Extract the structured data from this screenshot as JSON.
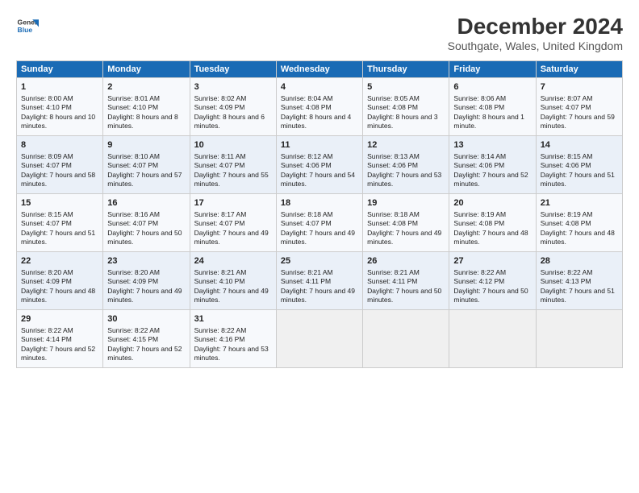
{
  "header": {
    "logo_line1": "General",
    "logo_line2": "Blue",
    "title": "December 2024",
    "subtitle": "Southgate, Wales, United Kingdom"
  },
  "days_of_week": [
    "Sunday",
    "Monday",
    "Tuesday",
    "Wednesday",
    "Thursday",
    "Friday",
    "Saturday"
  ],
  "weeks": [
    [
      {
        "day": "1",
        "sunrise": "Sunrise: 8:00 AM",
        "sunset": "Sunset: 4:10 PM",
        "daylight": "Daylight: 8 hours and 10 minutes."
      },
      {
        "day": "2",
        "sunrise": "Sunrise: 8:01 AM",
        "sunset": "Sunset: 4:10 PM",
        "daylight": "Daylight: 8 hours and 8 minutes."
      },
      {
        "day": "3",
        "sunrise": "Sunrise: 8:02 AM",
        "sunset": "Sunset: 4:09 PM",
        "daylight": "Daylight: 8 hours and 6 minutes."
      },
      {
        "day": "4",
        "sunrise": "Sunrise: 8:04 AM",
        "sunset": "Sunset: 4:08 PM",
        "daylight": "Daylight: 8 hours and 4 minutes."
      },
      {
        "day": "5",
        "sunrise": "Sunrise: 8:05 AM",
        "sunset": "Sunset: 4:08 PM",
        "daylight": "Daylight: 8 hours and 3 minutes."
      },
      {
        "day": "6",
        "sunrise": "Sunrise: 8:06 AM",
        "sunset": "Sunset: 4:08 PM",
        "daylight": "Daylight: 8 hours and 1 minute."
      },
      {
        "day": "7",
        "sunrise": "Sunrise: 8:07 AM",
        "sunset": "Sunset: 4:07 PM",
        "daylight": "Daylight: 7 hours and 59 minutes."
      }
    ],
    [
      {
        "day": "8",
        "sunrise": "Sunrise: 8:09 AM",
        "sunset": "Sunset: 4:07 PM",
        "daylight": "Daylight: 7 hours and 58 minutes."
      },
      {
        "day": "9",
        "sunrise": "Sunrise: 8:10 AM",
        "sunset": "Sunset: 4:07 PM",
        "daylight": "Daylight: 7 hours and 57 minutes."
      },
      {
        "day": "10",
        "sunrise": "Sunrise: 8:11 AM",
        "sunset": "Sunset: 4:07 PM",
        "daylight": "Daylight: 7 hours and 55 minutes."
      },
      {
        "day": "11",
        "sunrise": "Sunrise: 8:12 AM",
        "sunset": "Sunset: 4:06 PM",
        "daylight": "Daylight: 7 hours and 54 minutes."
      },
      {
        "day": "12",
        "sunrise": "Sunrise: 8:13 AM",
        "sunset": "Sunset: 4:06 PM",
        "daylight": "Daylight: 7 hours and 53 minutes."
      },
      {
        "day": "13",
        "sunrise": "Sunrise: 8:14 AM",
        "sunset": "Sunset: 4:06 PM",
        "daylight": "Daylight: 7 hours and 52 minutes."
      },
      {
        "day": "14",
        "sunrise": "Sunrise: 8:15 AM",
        "sunset": "Sunset: 4:06 PM",
        "daylight": "Daylight: 7 hours and 51 minutes."
      }
    ],
    [
      {
        "day": "15",
        "sunrise": "Sunrise: 8:15 AM",
        "sunset": "Sunset: 4:07 PM",
        "daylight": "Daylight: 7 hours and 51 minutes."
      },
      {
        "day": "16",
        "sunrise": "Sunrise: 8:16 AM",
        "sunset": "Sunset: 4:07 PM",
        "daylight": "Daylight: 7 hours and 50 minutes."
      },
      {
        "day": "17",
        "sunrise": "Sunrise: 8:17 AM",
        "sunset": "Sunset: 4:07 PM",
        "daylight": "Daylight: 7 hours and 49 minutes."
      },
      {
        "day": "18",
        "sunrise": "Sunrise: 8:18 AM",
        "sunset": "Sunset: 4:07 PM",
        "daylight": "Daylight: 7 hours and 49 minutes."
      },
      {
        "day": "19",
        "sunrise": "Sunrise: 8:18 AM",
        "sunset": "Sunset: 4:08 PM",
        "daylight": "Daylight: 7 hours and 49 minutes."
      },
      {
        "day": "20",
        "sunrise": "Sunrise: 8:19 AM",
        "sunset": "Sunset: 4:08 PM",
        "daylight": "Daylight: 7 hours and 48 minutes."
      },
      {
        "day": "21",
        "sunrise": "Sunrise: 8:19 AM",
        "sunset": "Sunset: 4:08 PM",
        "daylight": "Daylight: 7 hours and 48 minutes."
      }
    ],
    [
      {
        "day": "22",
        "sunrise": "Sunrise: 8:20 AM",
        "sunset": "Sunset: 4:09 PM",
        "daylight": "Daylight: 7 hours and 48 minutes."
      },
      {
        "day": "23",
        "sunrise": "Sunrise: 8:20 AM",
        "sunset": "Sunset: 4:09 PM",
        "daylight": "Daylight: 7 hours and 49 minutes."
      },
      {
        "day": "24",
        "sunrise": "Sunrise: 8:21 AM",
        "sunset": "Sunset: 4:10 PM",
        "daylight": "Daylight: 7 hours and 49 minutes."
      },
      {
        "day": "25",
        "sunrise": "Sunrise: 8:21 AM",
        "sunset": "Sunset: 4:11 PM",
        "daylight": "Daylight: 7 hours and 49 minutes."
      },
      {
        "day": "26",
        "sunrise": "Sunrise: 8:21 AM",
        "sunset": "Sunset: 4:11 PM",
        "daylight": "Daylight: 7 hours and 50 minutes."
      },
      {
        "day": "27",
        "sunrise": "Sunrise: 8:22 AM",
        "sunset": "Sunset: 4:12 PM",
        "daylight": "Daylight: 7 hours and 50 minutes."
      },
      {
        "day": "28",
        "sunrise": "Sunrise: 8:22 AM",
        "sunset": "Sunset: 4:13 PM",
        "daylight": "Daylight: 7 hours and 51 minutes."
      }
    ],
    [
      {
        "day": "29",
        "sunrise": "Sunrise: 8:22 AM",
        "sunset": "Sunset: 4:14 PM",
        "daylight": "Daylight: 7 hours and 52 minutes."
      },
      {
        "day": "30",
        "sunrise": "Sunrise: 8:22 AM",
        "sunset": "Sunset: 4:15 PM",
        "daylight": "Daylight: 7 hours and 52 minutes."
      },
      {
        "day": "31",
        "sunrise": "Sunrise: 8:22 AM",
        "sunset": "Sunset: 4:16 PM",
        "daylight": "Daylight: 7 hours and 53 minutes."
      },
      null,
      null,
      null,
      null
    ]
  ]
}
